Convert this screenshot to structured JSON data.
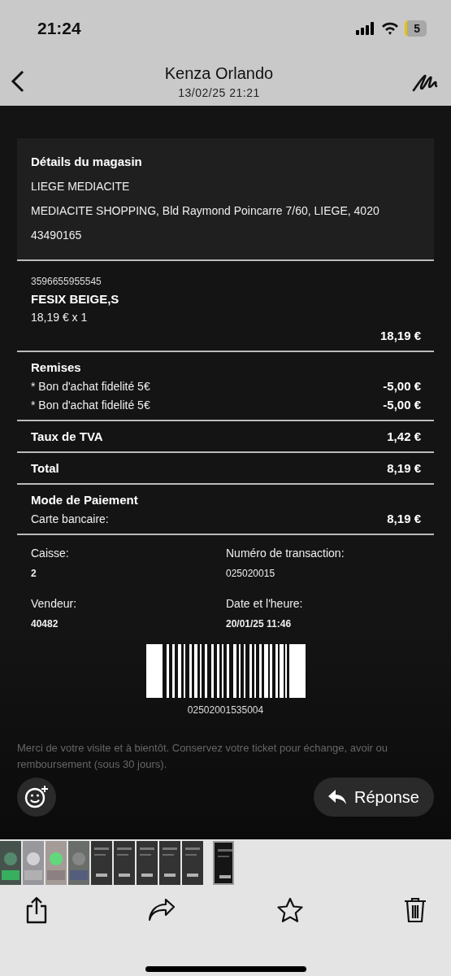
{
  "status_bar": {
    "time": "21:24",
    "battery": "5"
  },
  "header": {
    "title": "Kenza Orlando",
    "subtitle": "13/02/25 21:21"
  },
  "store": {
    "heading": "Détails du magasin",
    "lines": [
      "LIEGE MEDIACITE",
      "MEDIACITE SHOPPING, Bld Raymond Poincarre 7/60, LIEGE, 4020",
      "43490165"
    ]
  },
  "item": {
    "code": "3596655955545",
    "name": "FESIX BEIGE,S",
    "unit": "18,19 € x 1",
    "amount": "18,19 €"
  },
  "discounts": {
    "heading": "Remises",
    "rows": [
      {
        "label": "* Bon d'achat fidelité 5€",
        "amount": "-5,00 €"
      },
      {
        "label": "* Bon d'achat fidelité 5€",
        "amount": "-5,00 €"
      }
    ]
  },
  "vat": {
    "label": "Taux de TVA",
    "amount": "1,42 €"
  },
  "total": {
    "label": "Total",
    "amount": "8,19 €"
  },
  "payment": {
    "heading": "Mode de Paiement",
    "label": "Carte bancaire:",
    "amount": "8,19 €"
  },
  "info": [
    {
      "label": "Caisse:",
      "value": "2",
      "bold": true
    },
    {
      "label": "Numéro de transaction:",
      "value": "025020015",
      "bold": false
    },
    {
      "label": "Vendeur:",
      "value": "40482",
      "bold": true
    },
    {
      "label": "Date et l'heure:",
      "value": "20/01/25 11:46",
      "bold": true
    }
  ],
  "barcode_number": "02502001535004",
  "footer": "Merci de votre visite et à bientôt. Conservez votre ticket pour échange, avoir ou remboursement (sous 30 jours).",
  "reply_button": "Réponse",
  "thumbnails": [
    {
      "kind": "picture",
      "selected": false
    },
    {
      "kind": "picture",
      "selected": false
    },
    {
      "kind": "picture",
      "selected": false
    },
    {
      "kind": "picture",
      "selected": false
    },
    {
      "kind": "picture",
      "selected": false
    },
    {
      "kind": "picture",
      "selected": false
    },
    {
      "kind": "picture",
      "selected": false
    },
    {
      "kind": "picture",
      "selected": false
    },
    {
      "kind": "picture",
      "selected": false
    },
    {
      "kind": "picture",
      "selected": true
    }
  ]
}
